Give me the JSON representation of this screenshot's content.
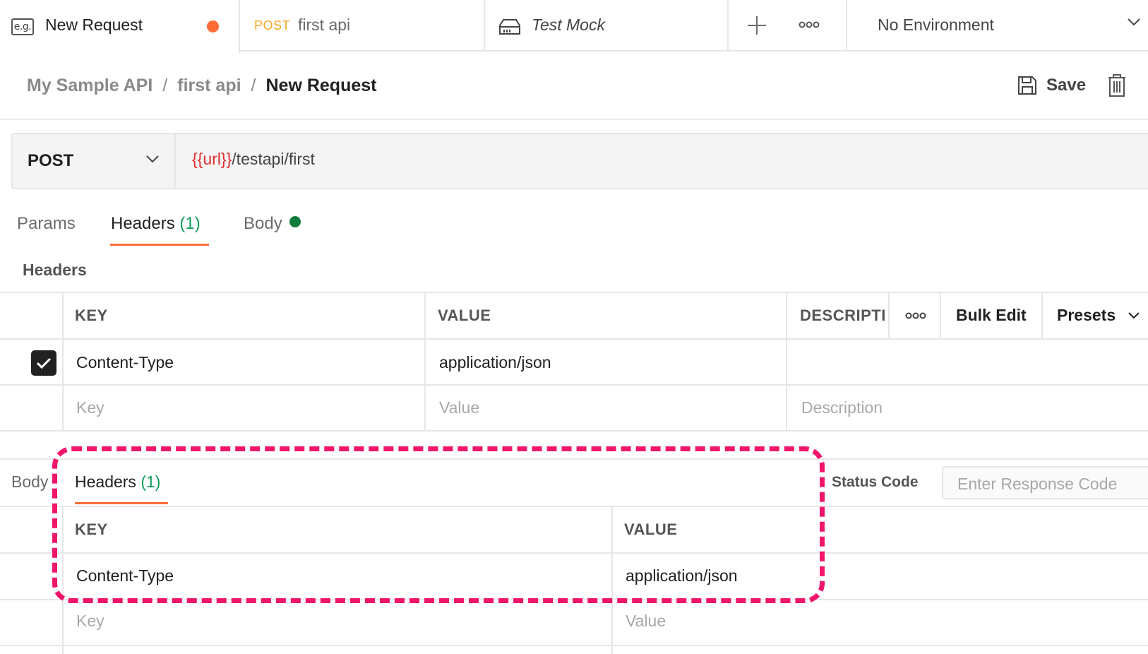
{
  "tabs": {
    "active": {
      "icon": "e.g.",
      "title": "New Request"
    },
    "post": {
      "method": "POST",
      "title": "first api"
    },
    "mock": {
      "title": "Test Mock"
    }
  },
  "environment": {
    "selected": "No Environment"
  },
  "breadcrumb": {
    "collection": "My Sample API",
    "folder": "first api",
    "current": "New Request",
    "separator": "/"
  },
  "actions": {
    "save_label": "Save"
  },
  "request": {
    "method": "POST",
    "url_variable": "{{url}}",
    "url_path": "/testapi/first"
  },
  "request_tabs": {
    "params": "Params",
    "headers": "Headers",
    "headers_count": "(1)",
    "body": "Body"
  },
  "headers_section": {
    "title": "Headers",
    "columns": {
      "key": "KEY",
      "value": "VALUE",
      "description": "DESCRIPTI"
    },
    "bulk_edit": "Bulk Edit",
    "presets": "Presets",
    "rows": [
      {
        "key": "Content-Type",
        "value": "application/json",
        "enabled": true
      }
    ],
    "placeholders": {
      "key": "Key",
      "value": "Value",
      "description": "Description"
    }
  },
  "response": {
    "tab_body": "Body",
    "tab_headers": "Headers",
    "headers_count": "(1)",
    "status_label": "Status Code",
    "status_placeholder": "Enter Response Code",
    "columns": {
      "key": "KEY",
      "value": "VALUE"
    },
    "rows": [
      {
        "key": "Content-Type",
        "value": "application/json"
      }
    ],
    "placeholders": {
      "key": "Key",
      "value": "Value"
    }
  },
  "colors": {
    "accent": "#ff6c37",
    "post_method": "#f5a623",
    "url_variable": "#e12d2d",
    "count_green": "#0f9d58",
    "highlight": "#f0166b"
  }
}
